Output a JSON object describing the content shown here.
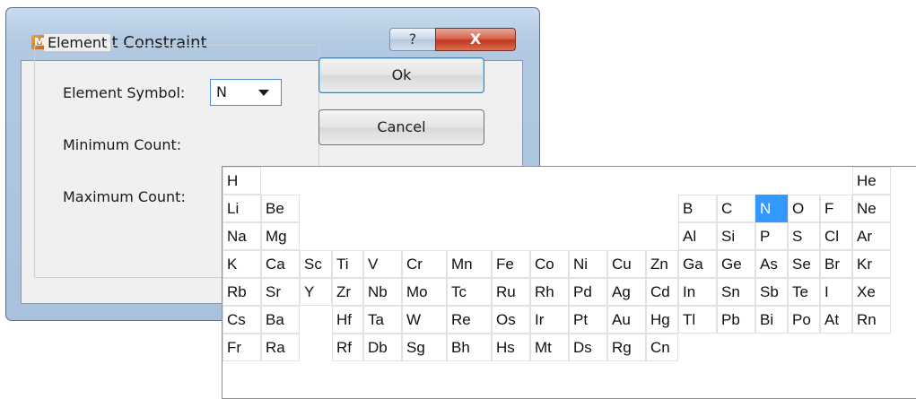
{
  "dialog": {
    "title": "Element Constraint",
    "help_glyph": "?",
    "close_glyph": "X",
    "app_icon_letter": "M"
  },
  "element_group": {
    "label": "Element",
    "symbol_label": "Element Symbol:",
    "symbol_value": "N",
    "min_label": "Minimum Count:",
    "max_label": "Maximum Count:"
  },
  "buttons": {
    "ok": "Ok",
    "cancel": "Cancel"
  },
  "periodic_table": {
    "selected": "N",
    "selection_color": "#3399ff",
    "rows": [
      [
        "H",
        "",
        "",
        "",
        "",
        "",
        "",
        "",
        "",
        "",
        "",
        "",
        "",
        "",
        "",
        "",
        "",
        "He"
      ],
      [
        "Li",
        "Be",
        "",
        "",
        "",
        "",
        "",
        "",
        "",
        "",
        "",
        "",
        "B",
        "C",
        "N",
        "O",
        "F",
        "Ne"
      ],
      [
        "Na",
        "Mg",
        "",
        "",
        "",
        "",
        "",
        "",
        "",
        "",
        "",
        "",
        "Al",
        "Si",
        "P",
        "S",
        "Cl",
        "Ar"
      ],
      [
        "K",
        "Ca",
        "Sc",
        "Ti",
        "V",
        "Cr",
        "Mn",
        "Fe",
        "Co",
        "Ni",
        "Cu",
        "Zn",
        "Ga",
        "Ge",
        "As",
        "Se",
        "Br",
        "Kr"
      ],
      [
        "Rb",
        "Sr",
        "Y",
        "Zr",
        "Nb",
        "Mo",
        "Tc",
        "Ru",
        "Rh",
        "Pd",
        "Ag",
        "Cd",
        "In",
        "Sn",
        "Sb",
        "Te",
        "I",
        "Xe"
      ],
      [
        "Cs",
        "Ba",
        "",
        "Hf",
        "Ta",
        "W",
        "Re",
        "Os",
        "Ir",
        "Pt",
        "Au",
        "Hg",
        "Tl",
        "Pb",
        "Bi",
        "Po",
        "At",
        "Rn"
      ],
      [
        "Fr",
        "Ra",
        "",
        "Rf",
        "Db",
        "Sg",
        "Bh",
        "Hs",
        "Mt",
        "Ds",
        "Rg",
        "Cn",
        "",
        "",
        "",
        "",
        "",
        ""
      ]
    ]
  }
}
